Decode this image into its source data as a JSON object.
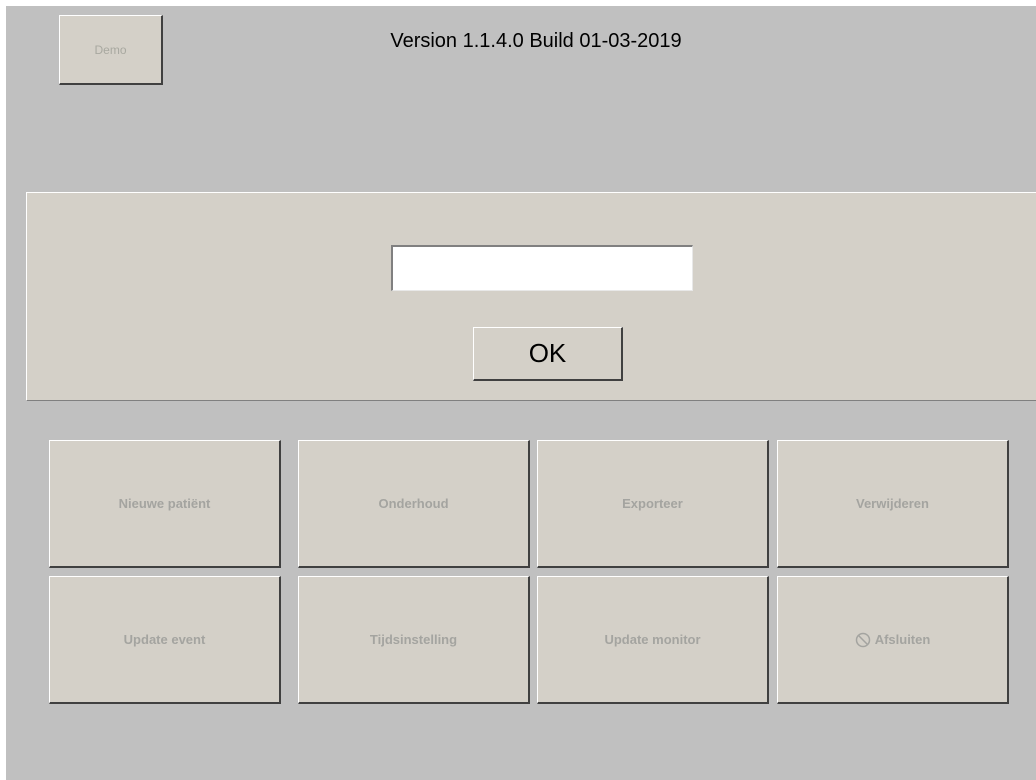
{
  "header": {
    "demo_label": "Demo",
    "version_text": "Version 1.1.4.0 Build 01-03-2019"
  },
  "login": {
    "input_value": "",
    "ok_label": "OK"
  },
  "buttons": {
    "new_patient": "Nieuwe patiënt",
    "maintenance": "Onderhoud",
    "export": "Exporteer",
    "delete": "Verwijderen",
    "update_event": "Update event",
    "time_setting": "Tijdsinstelling",
    "update_monitor": "Update monitor",
    "exit": "Afsluiten",
    "exit_icon": "prohibited-icon"
  },
  "colors": {
    "background": "#c0c0c0",
    "panel": "#d4d0c8",
    "disabled_text": "#a4a4a0"
  }
}
